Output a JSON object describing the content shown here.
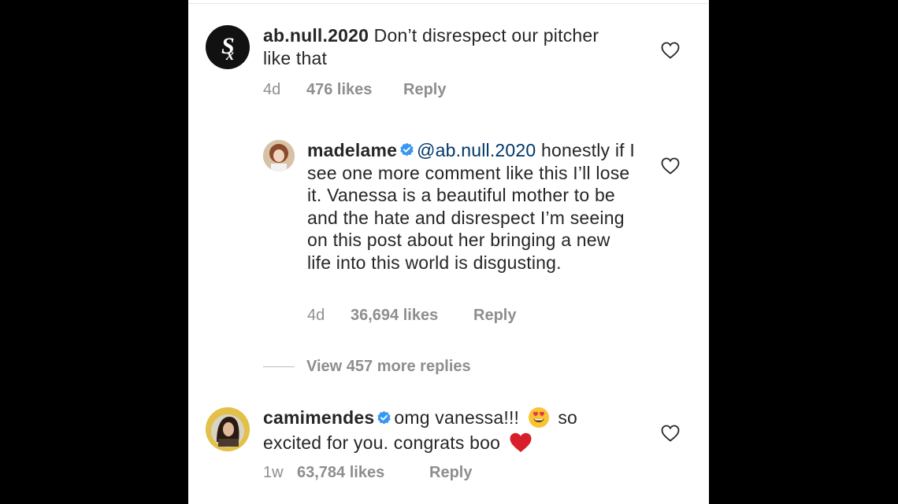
{
  "comments": [
    {
      "username": "ab.null.2020",
      "text": "Don’t disrespect our pitcher like that",
      "time": "4d",
      "likes": "476 likes",
      "reply_label": "Reply",
      "avatar_icon": "white-sox-logo-icon"
    },
    {
      "username": "madelame",
      "verified": true,
      "mention": "@ab.null.2020",
      "text": "honestly if I see one more comment like this I’ll lose it. Vanessa is a beautiful mother to be and the hate and disrespect I’m seeing on this post about her bringing a new life into this world is disgusting.",
      "time": "4d",
      "likes": "36,694 likes",
      "reply_label": "Reply"
    },
    {
      "username": "camimendes",
      "verified": true,
      "text_part1": "omg vanessa!!!",
      "text_part2": "so excited for you. congrats boo",
      "emoji1": "heart-eyes-emoji",
      "emoji2": "red-heart-emoji",
      "time": "1w",
      "likes": "63,784 likes",
      "reply_label": "Reply"
    }
  ],
  "view_more": "View 457 more replies",
  "colors": {
    "text": "#262626",
    "meta": "#8e8e8e",
    "mention": "#00376b",
    "verified": "#3897f0",
    "heart_red": "#ed4956"
  }
}
